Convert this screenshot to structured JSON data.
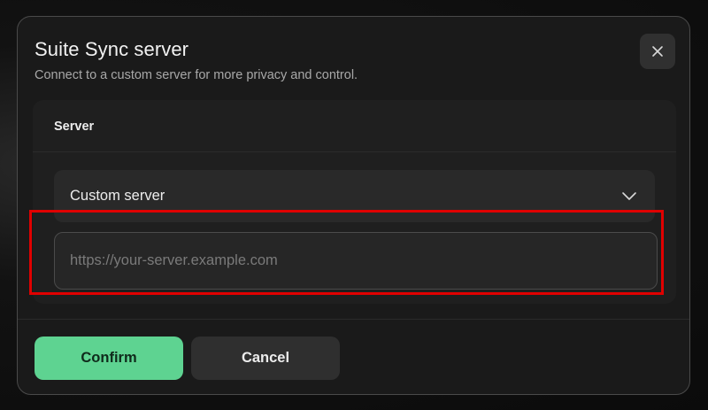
{
  "dialog": {
    "title": "Suite Sync server",
    "subtitle": "Connect to a custom server for more privacy and control."
  },
  "server_panel": {
    "heading": "Server",
    "select": {
      "selected": "Custom server"
    },
    "url_input": {
      "value": "",
      "placeholder": "https://your-server.example.com"
    }
  },
  "actions": {
    "confirm_label": "Confirm",
    "cancel_label": "Cancel"
  },
  "colors": {
    "accent": "#5ed391",
    "highlight": "#e00000",
    "dialog_bg": "#1a1a1a"
  },
  "icons": {
    "close": "close-icon",
    "chevron": "chevron-down-icon"
  }
}
